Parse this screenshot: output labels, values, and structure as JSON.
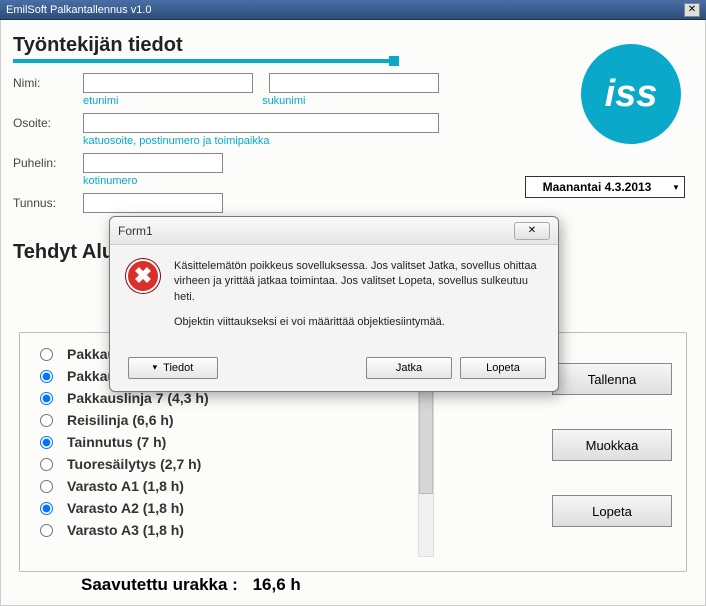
{
  "window": {
    "title": "EmilSoft Palkantallennus v1.0"
  },
  "logo_text": "iss",
  "header1": "Työntekijän tiedot",
  "labels": {
    "nimi": "Nimi:",
    "osoite": "Osoite:",
    "puhelin": "Puhelin:",
    "tunnus": "Tunnus:"
  },
  "hints": {
    "etunimi": "etunimi",
    "sukunimi": "sukunimi",
    "osoite": "katuosoite, postinumero ja toimipaikka",
    "puhelin": "kotinumero"
  },
  "date": {
    "selected": "Maanantai 4.3.2013"
  },
  "header2": "Tehdyt Alu",
  "actions": {
    "save": "Tallenna",
    "edit": "Muokkaa",
    "quit": "Lopeta"
  },
  "radios": [
    {
      "label": "Pakkaus",
      "checked": false
    },
    {
      "label": "Pakkaus",
      "checked": true
    },
    {
      "label": "Pakkauslinja 7 (4,3 h)",
      "checked": true
    },
    {
      "label": "Reisilinja (6,6 h)",
      "checked": false
    },
    {
      "label": "Tainnutus (7 h)",
      "checked": true
    },
    {
      "label": "Tuoresäilytys (2,7 h)",
      "checked": false
    },
    {
      "label": "Varasto A1 (1,8 h)",
      "checked": false
    },
    {
      "label": "Varasto A2 (1,8 h)",
      "checked": true
    },
    {
      "label": "Varasto A3 (1,8 h)",
      "checked": false
    }
  ],
  "summary": {
    "label": "Saavutettu urakka :",
    "value": "16,6 h"
  },
  "dialog": {
    "title": "Form1",
    "msg1": "Käsittelemätön poikkeus sovelluksessa. Jos valitset Jatka, sovellus ohittaa virheen ja yrittää jatkaa toimintaa. Jos valitset Lopeta, sovellus sulkeutuu heti.",
    "msg2": "Objektin viittaukseksi ei voi määrittää objektiesiintymää.",
    "details": "Tiedot",
    "continue": "Jatka",
    "quit": "Lopeta"
  }
}
